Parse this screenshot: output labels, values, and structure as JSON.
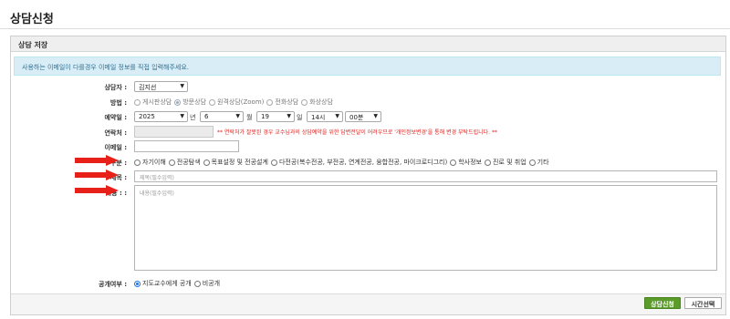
{
  "page": {
    "title": "상담신청"
  },
  "panel": {
    "heading": "상담 저장"
  },
  "alert": {
    "message": "사용하는 이메일이 다를경우 이메일 정보를 직접 입력해주세요."
  },
  "labels": {
    "counselor": "상담자 :",
    "method": "방법 :",
    "date": "예약일 :",
    "contact": "연락처 :",
    "email": "이메일 :",
    "category": "구분 :",
    "subject": "제목 :",
    "content": "내용 : :",
    "visibility": "공개여부 :"
  },
  "counselor": {
    "selected": "김지선"
  },
  "method": {
    "options": [
      {
        "label": "게시판상담",
        "selected": false,
        "disabled": true
      },
      {
        "label": "방문상담",
        "selected": true,
        "disabled": true
      },
      {
        "label": "원격상담(Zoom)",
        "selected": false,
        "disabled": true
      },
      {
        "label": "전화상담",
        "selected": false,
        "disabled": true
      },
      {
        "label": "화상상담",
        "selected": false,
        "disabled": true
      }
    ]
  },
  "date": {
    "year": "2025",
    "year_unit": "년",
    "month": "6",
    "month_unit": "월",
    "day": "19",
    "day_unit": "일",
    "hour": "14시",
    "minute": "00분"
  },
  "contact": {
    "value": "",
    "warning": "** 연락처가 잘못된 경우 교수님과의 상담예약을 위한 답변전달이 어려우므로 '개인정보변경'을 통해 변경 부탁드립니다. **"
  },
  "email": {
    "value": ""
  },
  "category": {
    "options": [
      {
        "label": "자기이해",
        "selected": false
      },
      {
        "label": "전공탐색",
        "selected": false
      },
      {
        "label": "목표설정 및 전공설계",
        "selected": false
      },
      {
        "label": "다전공(복수전공, 부전공, 연계전공, 융합전공, 마이크로디그리)",
        "selected": false
      },
      {
        "label": "학사정보",
        "selected": false
      },
      {
        "label": "진로 및 취업",
        "selected": false
      },
      {
        "label": "기타",
        "selected": false
      }
    ]
  },
  "subject": {
    "placeholder": "제목(필수입력)"
  },
  "content": {
    "placeholder": "내용(필수입력)"
  },
  "visibility": {
    "options": [
      {
        "label": "지도교수에게 공개",
        "selected": true
      },
      {
        "label": "비공개",
        "selected": false
      }
    ]
  },
  "buttons": {
    "submit": "상담신청",
    "time_select": "시간선택"
  },
  "colors": {
    "arrow": "#e8201a",
    "submit": "#5a9b2a",
    "alert_bg": "#d9edf7",
    "warning": "#e0211d"
  }
}
